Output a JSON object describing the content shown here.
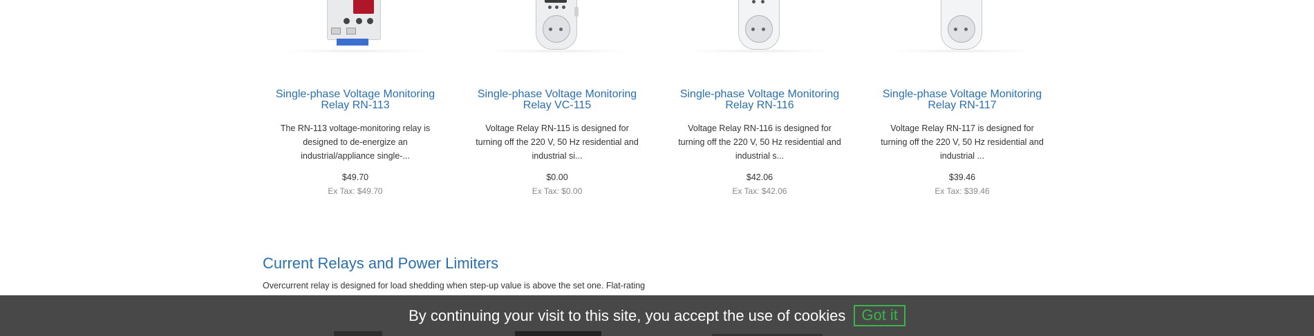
{
  "products": [
    {
      "title": "Single-phase Voltage Monitoring Relay RN-113",
      "description": "The RN-113 voltage-monitoring relay is designed to de-energize an industrial/appliance single-...",
      "price": "$49.70",
      "ex_tax": "Ex Tax: $49.70",
      "image": "din-rail-relay"
    },
    {
      "title": "Single-phase Voltage Monitoring Relay VC-115",
      "description": "Voltage Relay RN-115 is designed for turning off the 220 V, 50 Hz residential and industrial si...",
      "price": "$0.00",
      "ex_tax": "Ex Tax: $0.00",
      "image": "plug-in-relay"
    },
    {
      "title": "Single-phase Voltage Monitoring Relay RN-116",
      "description": "Voltage Relay RN-116 is designed for turning off the 220 V, 50 Hz residential and industrial s...",
      "price": "$42.06",
      "ex_tax": "Ex Tax: $42.06",
      "image": "plug-in-relay"
    },
    {
      "title": "Single-phase Voltage Monitoring Relay RN-117",
      "description": "Voltage Relay RN-117 is designed for turning off the 220 V, 50 Hz residential and industrial ...",
      "price": "$39.46",
      "ex_tax": "Ex Tax: $39.46",
      "image": "plug-in-relay"
    }
  ],
  "section": {
    "title": "Current Relays and Power Limiters",
    "description": "Overcurrent relay is designed for load shedding when step-up value is above the set one. Flat-rating"
  },
  "cookie": {
    "message": "By continuing your visit to this site, you accept the use of cookies",
    "button_label": "Got it"
  },
  "colors": {
    "link": "#2a6fb0",
    "cookie_accent": "#3bb54a",
    "cookie_bg": "#333333"
  }
}
